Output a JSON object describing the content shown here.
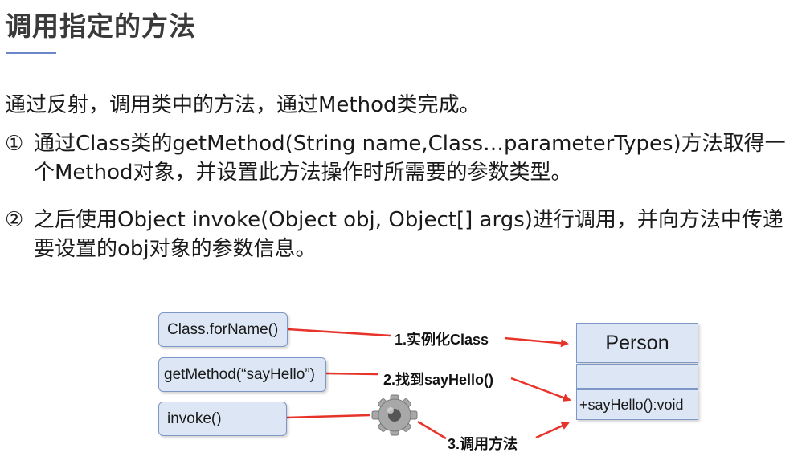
{
  "title": "调用指定的方法",
  "intro": "通过反射，调用类中的方法，通过Method类完成。",
  "steps": [
    {
      "num": "①",
      "text": "通过Class类的getMethod(String name,Class…parameterTypes)方法取得一个Method对象，并设置此方法操作时所需要的参数类型。"
    },
    {
      "num": "②",
      "text": "之后使用Object invoke(Object obj, Object[] args)进行调用，并向方法中传递要设置的obj对象的参数信息。"
    }
  ],
  "diagram": {
    "boxes": [
      "Class.forName()",
      "getMethod(“sayHello”)",
      "invoke()"
    ],
    "arrow_labels": [
      "1.实例化Class",
      "2.找到sayHello()",
      "3.调用方法"
    ],
    "person": {
      "name": "Person",
      "method": "+sayHello():void"
    },
    "colors": {
      "arrow": "#e8332a",
      "box_fill": "#dce6f4",
      "box_border": "#7d97c6"
    },
    "icons": [
      "gear-icon"
    ]
  }
}
